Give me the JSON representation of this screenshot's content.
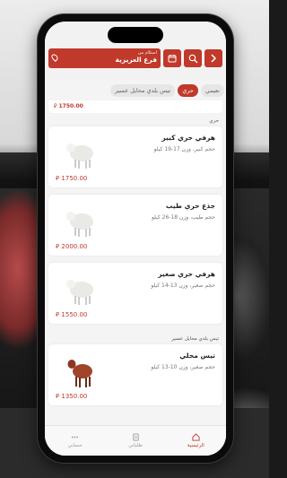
{
  "header": {
    "pickup_label": "استلام من",
    "branch_name": "فرع العزيزية",
    "icons": [
      "chevron-right-icon",
      "search-icon",
      "calendar-icon",
      "location-pin-icon"
    ]
  },
  "tabs": [
    {
      "label": "نعيمي",
      "active": false
    },
    {
      "label": "حري",
      "active": true
    },
    {
      "label": "تيس بلدي محايل عسير",
      "active": false
    }
  ],
  "peek_price": "1750.00",
  "sections": [
    {
      "title": "حري",
      "items": [
        {
          "name": "هرفي حري كبير",
          "desc": "حجم كبير، وزن 17-19 كيلو",
          "price": "1750.00",
          "currency_icon": "riyal-icon",
          "image": "white-sheep"
        },
        {
          "name": "جذع حري طيب",
          "desc": "حجم طيب، وزن 18-26 كيلو",
          "price": "2000.00",
          "currency_icon": "riyal-icon",
          "image": "white-sheep"
        },
        {
          "name": "هرفي حري صغير",
          "desc": "حجم صغير، وزن 13-14 كيلو",
          "price": "1550.00",
          "currency_icon": "riyal-icon",
          "image": "white-sheep"
        }
      ]
    },
    {
      "title": "تيس بلدي محايل عسير",
      "items": [
        {
          "name": "تيس محلي",
          "desc": "حجم صغير، وزن 10-13 كيلو",
          "price": "1350.00",
          "currency_icon": "riyal-icon",
          "image": "brown-goat"
        }
      ]
    }
  ],
  "tabbar": [
    {
      "label": "الرئيسية",
      "icon": "home-icon",
      "active": true
    },
    {
      "label": "طلباتي",
      "icon": "orders-icon",
      "active": false
    },
    {
      "label": "حسابي",
      "icon": "more-icon",
      "active": false
    }
  ],
  "colors": {
    "accent": "#c0392b",
    "background": "#f4f4f4",
    "card": "#ffffff"
  }
}
